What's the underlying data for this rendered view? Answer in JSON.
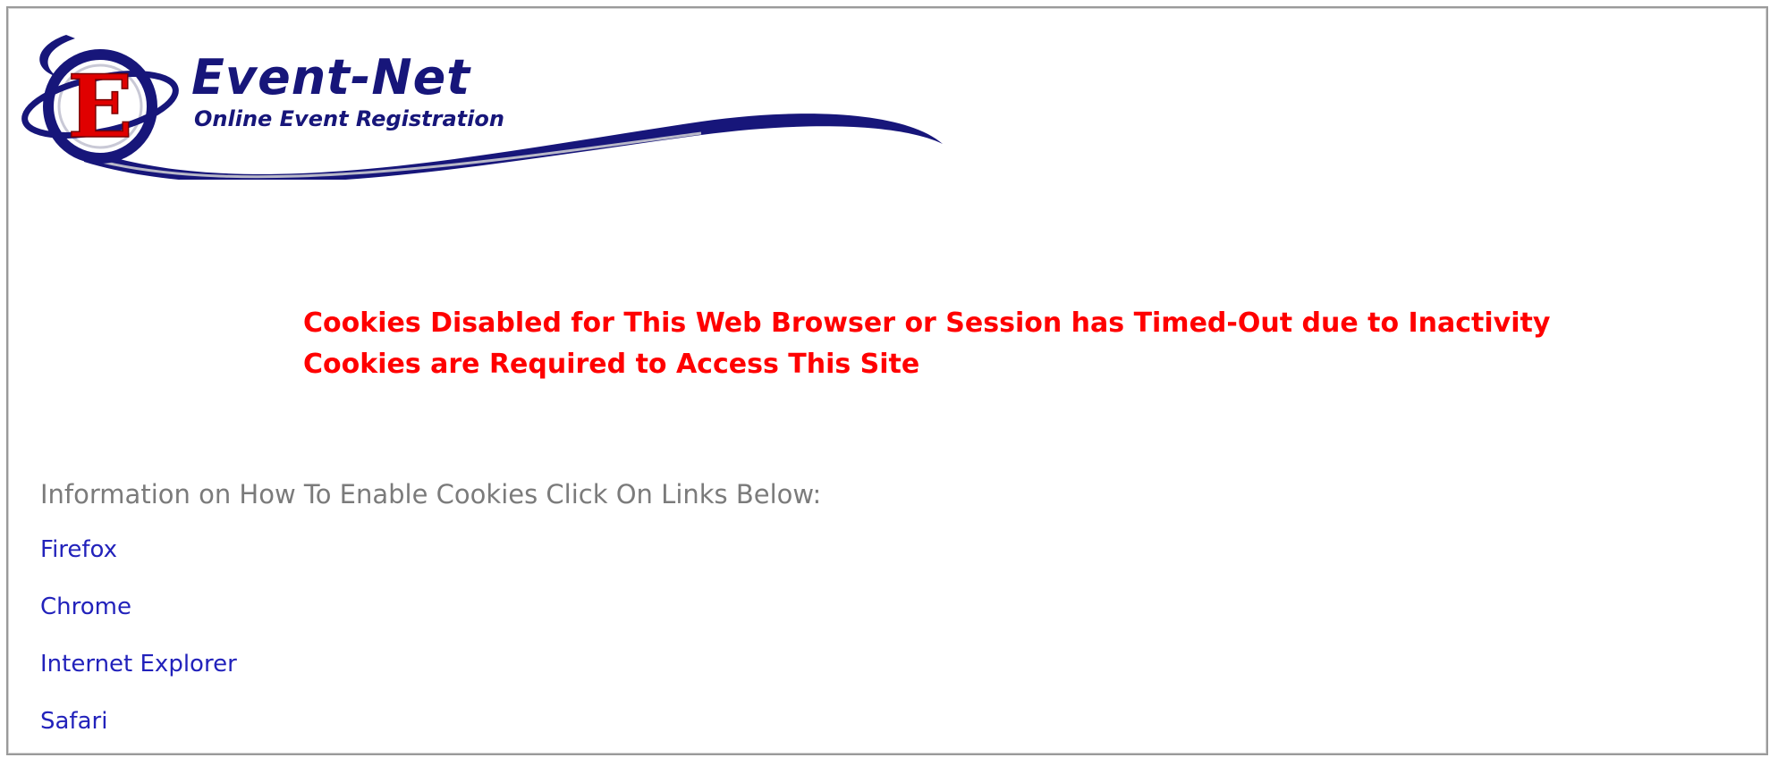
{
  "logo": {
    "letter": "E",
    "title": "Event-Net",
    "subtitle": "Online Event Registration"
  },
  "error": {
    "line1": "Cookies Disabled for This Web Browser or Session has Timed-Out due to Inactivity",
    "line2": "Cookies are Required to Access This Site"
  },
  "info": {
    "heading": "Information on How To Enable Cookies Click On Links Below:"
  },
  "links": [
    {
      "label": "Firefox"
    },
    {
      "label": "Chrome"
    },
    {
      "label": "Internet Explorer"
    },
    {
      "label": "Safari"
    }
  ],
  "colors": {
    "error": "#ff0000",
    "link": "#2222bb",
    "heading": "#7b7b7b",
    "brand": "#17167a"
  }
}
